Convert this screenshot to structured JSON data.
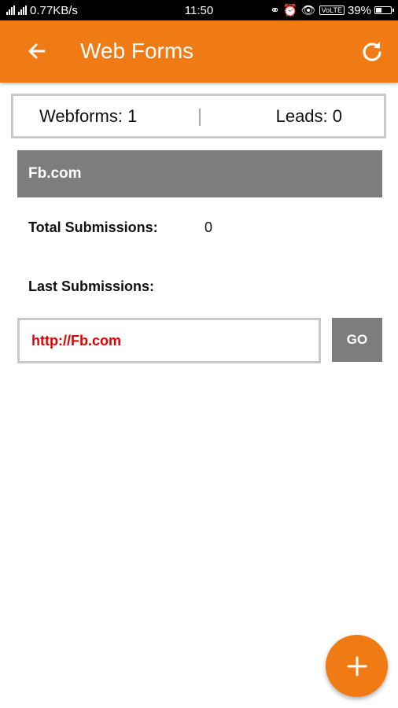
{
  "status_bar": {
    "network_speed": "0.77KB/s",
    "time": "11:50",
    "battery": "39%",
    "volte": "VoLTE"
  },
  "app_bar": {
    "title": "Web Forms"
  },
  "stats": {
    "webforms": "Webforms: 1",
    "leads": "Leads: 0"
  },
  "form": {
    "name": "Fb.com",
    "total_label": "Total Submissions:",
    "total_value": "0",
    "last_label": "Last Submissions:",
    "url": "http://Fb.com",
    "go_label": "GO"
  },
  "colors": {
    "accent": "#f07b14",
    "header_gray": "#7d7d7d",
    "url_red": "#e00000"
  }
}
